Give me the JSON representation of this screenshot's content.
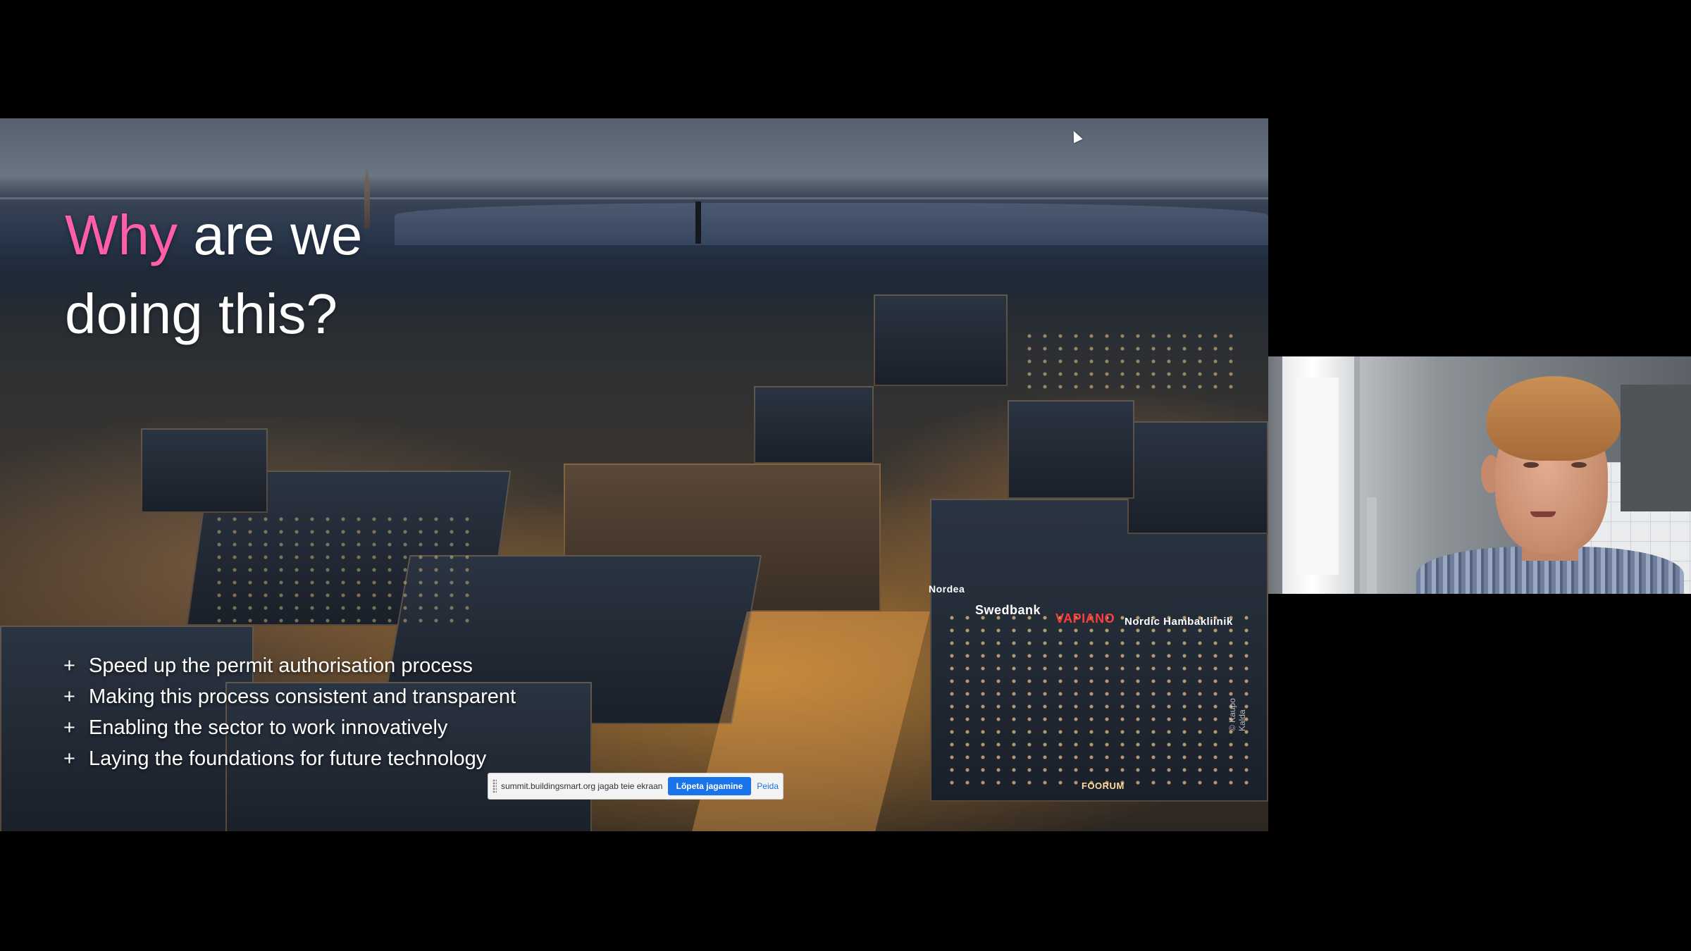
{
  "slide": {
    "title_accent": "Why",
    "title_line1_rest": " are we",
    "title_line2": "doing this?",
    "bullets": [
      "Speed up the permit authorisation process",
      "Making this process consistent and transparent",
      "Enabling the sector to work innovatively",
      "Laying the foundations for future technology"
    ],
    "signs": {
      "nordea": "Nordea",
      "swedbank": "Swedbank",
      "vapiano": "VAPIANO",
      "nordic": "Nordic Hambakliinik",
      "foorum": "FOORUM"
    },
    "copyright": "© Kaupo Kalda",
    "accent_color": "#ff5fa6"
  },
  "share_bar": {
    "message": "summit.buildingsmart.org jagab teie ekraani.",
    "stop_label": "Lõpeta jagamine",
    "hide_label": "Peida"
  },
  "webcam": {
    "icon": "participant-video"
  }
}
